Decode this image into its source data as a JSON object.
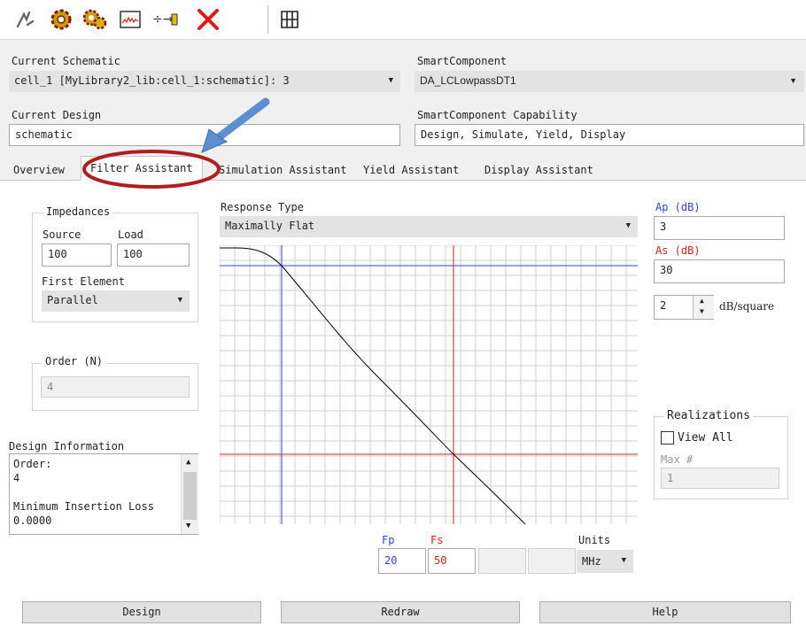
{
  "toolbar": {
    "icons": [
      "tune-icon",
      "gear-icon",
      "gear-double-icon",
      "waveform-display-icon",
      "component-align-icon",
      "delete-x-icon",
      "grid-layout-icon"
    ]
  },
  "top": {
    "current_schematic_label": "Current Schematic",
    "current_schematic_value": "cell_1 [MyLibrary2_lib:cell_1:schematic]: 3",
    "smart_component_label": "SmartComponent",
    "smart_component_value": "DA_LCLowpassDT1",
    "current_design_label": "Current Design",
    "current_design_value": "schematic",
    "capability_label": "SmartComponent Capability",
    "capability_value": "Design, Simulate, Yield, Display"
  },
  "tabs": [
    {
      "label": "Overview"
    },
    {
      "label": "Filter Assistant"
    },
    {
      "label": "Simulation Assistant"
    },
    {
      "label": "Yield Assistant"
    },
    {
      "label": "Display Assistant"
    }
  ],
  "impedances": {
    "title": "Impedances",
    "source_label": "Source",
    "load_label": "Load",
    "source_value": "100",
    "load_value": "100",
    "first_element_label": "First Element",
    "first_element_value": "Parallel"
  },
  "order": {
    "title": "Order (N)",
    "value": "4"
  },
  "design_info": {
    "title": "Design Information",
    "line1": "Order:",
    "line2": "4",
    "line3": "Minimum Insertion Loss",
    "line4": "0.0000"
  },
  "response": {
    "label": "Response Type",
    "value": "Maximally Flat"
  },
  "right": {
    "ap_label": "Ap (dB)",
    "ap_value": "3",
    "as_label": "As (dB)",
    "as_value": "30",
    "spin_value": "2",
    "spin_unit": "dB/square",
    "realizations_title": "Realizations",
    "view_all_label": "View All",
    "max_label": "Max #",
    "max_value": "1"
  },
  "freq": {
    "fp_label": "Fp",
    "fp_value": "20",
    "fs_label": "Fs",
    "fs_value": "50",
    "units_label": "Units",
    "units_value": "MHz"
  },
  "buttons": {
    "design": "Design",
    "redraw": "Redraw",
    "help": "Help"
  },
  "colors": {
    "fp_line": "#3344cc",
    "fs_line": "#cc2222",
    "annotation_ellipse": "#b01e1e",
    "annotation_arrow": "#5b8fd1"
  }
}
